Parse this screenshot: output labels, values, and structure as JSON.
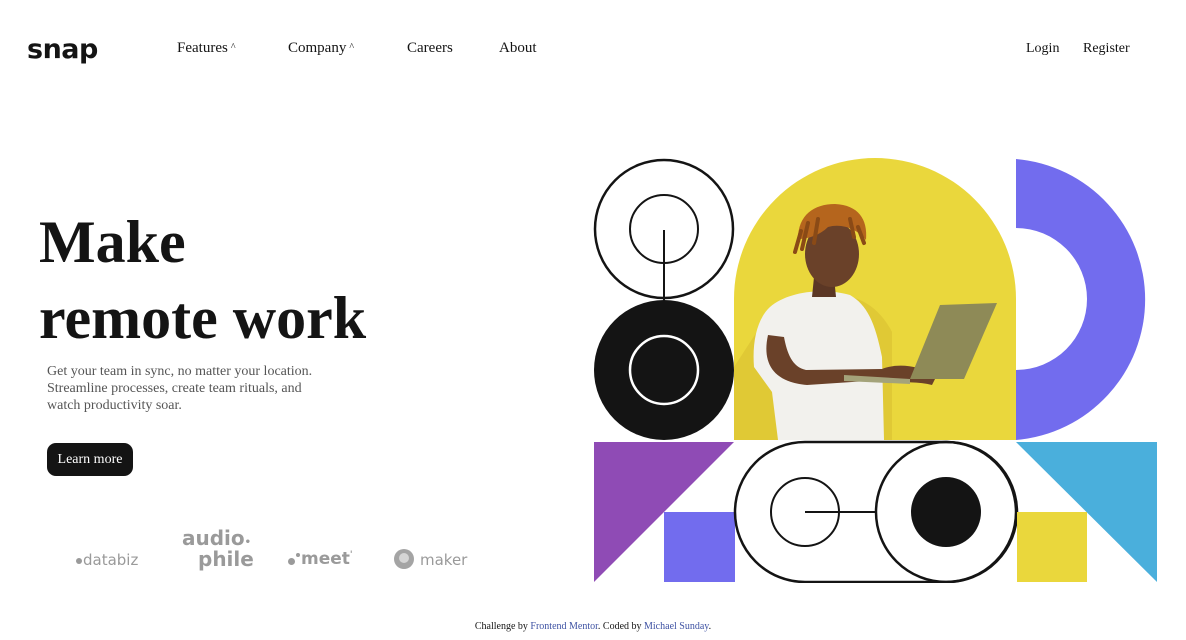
{
  "brand": {
    "logo": "snap"
  },
  "nav": {
    "items": [
      {
        "label": "Features",
        "caret": "^"
      },
      {
        "label": "Company",
        "caret": "^"
      },
      {
        "label": "Careers"
      },
      {
        "label": "About"
      }
    ],
    "login": "Login",
    "register": "Register"
  },
  "hero": {
    "title_line1": "Make",
    "title_line2": "remote work",
    "description_line1": "Get your team in sync, no matter your location.",
    "description_line2": "Streamline processes, create team rituals, and",
    "description_line3": "watch productivity soar.",
    "cta": "Learn more"
  },
  "clients": {
    "databiz": "databiz",
    "audiophile_line1": "audio",
    "audiophile_line2": "phile",
    "meet": "meet",
    "maker": "maker"
  },
  "footer": {
    "prefix": "Challenge by ",
    "challenge_link": "Frontend Mentor",
    "middle": ". Coded by ",
    "author_link": "Michael Sunday",
    "suffix": "."
  },
  "colors": {
    "dark": "#141414",
    "yellow": "#ead73c",
    "purple": "#8f4bb5",
    "indigo": "#726cee",
    "sky": "#4aafdc",
    "link": "#3e52a3"
  }
}
